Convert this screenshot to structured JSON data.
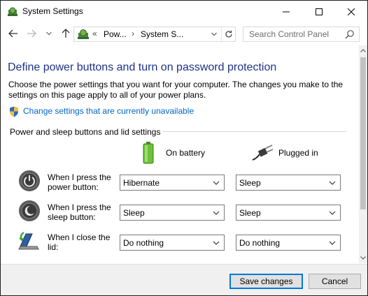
{
  "window": {
    "title": "System Settings"
  },
  "addressbar": {
    "overflow": "«",
    "crumbs": [
      "Pow...",
      "System S..."
    ],
    "separator": "›"
  },
  "search": {
    "placeholder": "Search Control Panel"
  },
  "page": {
    "heading": "Define power buttons and turn on password protection",
    "description": "Choose the power settings that you want for your computer. The changes you make to the settings on this page apply to all of your power plans.",
    "admin_link": "Change settings that are currently unavailable",
    "section_title": "Power and sleep buttons and lid settings",
    "columns": {
      "battery": "On battery",
      "plugged": "Plugged in"
    },
    "rows": [
      {
        "label": "When I press the power button:",
        "battery": "Hibernate",
        "plugged": "Sleep"
      },
      {
        "label": "When I press the sleep button:",
        "battery": "Sleep",
        "plugged": "Sleep"
      },
      {
        "label": "When I close the lid:",
        "battery": "Do nothing",
        "plugged": "Do nothing"
      }
    ]
  },
  "footer": {
    "save": "Save changes",
    "cancel": "Cancel"
  },
  "icons": {
    "title": "control-panel-icon",
    "back": "back-arrow-icon",
    "forward": "forward-arrow-icon",
    "recent": "chevron-down-icon",
    "up": "up-arrow-icon",
    "refresh": "refresh-icon",
    "search": "search-icon",
    "shield": "uac-shield-icon",
    "battery": "battery-icon",
    "plug": "power-plug-icon",
    "power": "power-button-icon",
    "sleep": "sleep-moon-icon",
    "lid": "laptop-lid-icon"
  },
  "colors": {
    "heading": "#1e3287",
    "link": "#0066cc",
    "accent": "#0078d7"
  }
}
